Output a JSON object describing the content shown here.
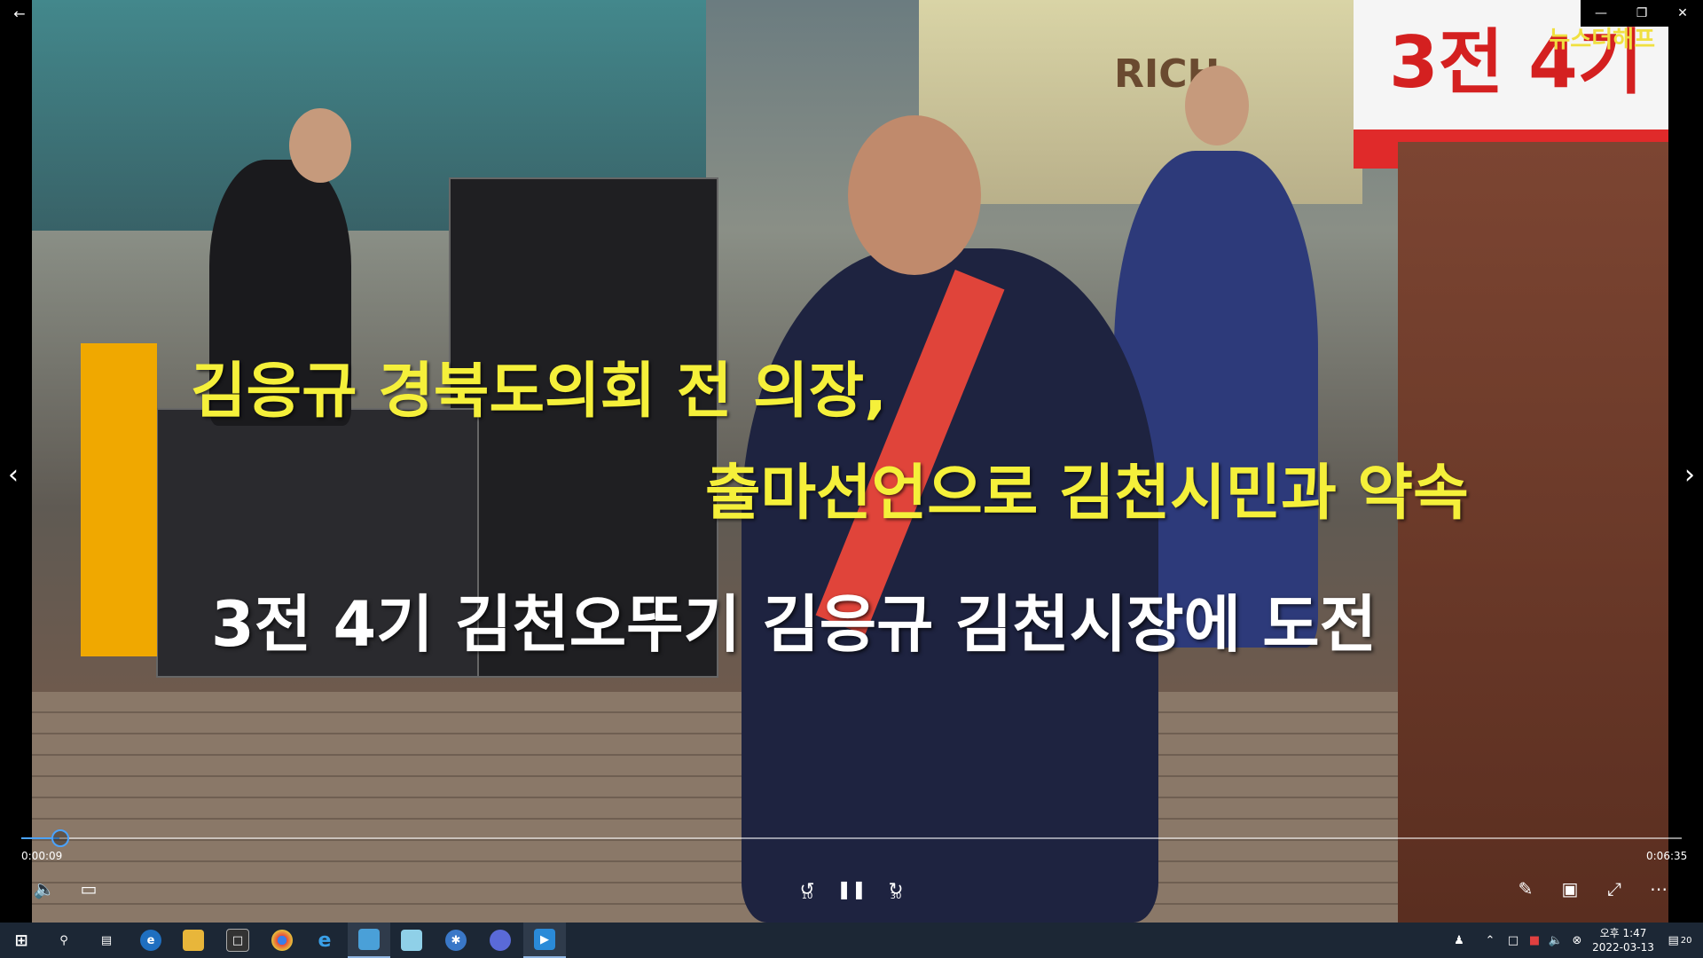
{
  "player": {
    "watermark": "뉴스더해프",
    "current_time": "0:00:09",
    "total_time": "0:06:35",
    "progress": 0.023,
    "skip_back_label": "10",
    "skip_forward_label": "30"
  },
  "captions": {
    "line1": "김응규 경북도의회 전 의장,",
    "line2": "출마선언으로 김천시민과 약속",
    "line3": "3전 4기 김천오뚜기 김응규 김천시장에 도전",
    "line1_color": "#f5f03a",
    "line3_color": "#ffffff",
    "accent_bar_color": "#f0a800"
  },
  "scene": {
    "banner_text": "3전 4기",
    "sign_text": "RICH"
  },
  "taskbar": {
    "apps": [
      "start-icon",
      "search-icon",
      "task-view-icon",
      "edge-icon",
      "file-explorer-icon",
      "store-icon",
      "chrome-icon",
      "ie-icon",
      "app-icon",
      "notepad-icon",
      "settings-app-icon",
      "app2-icon",
      "movies-tv-icon"
    ],
    "ime": "",
    "time": "오후 1:47",
    "date": "2022-03-13",
    "notification_count": "20"
  }
}
